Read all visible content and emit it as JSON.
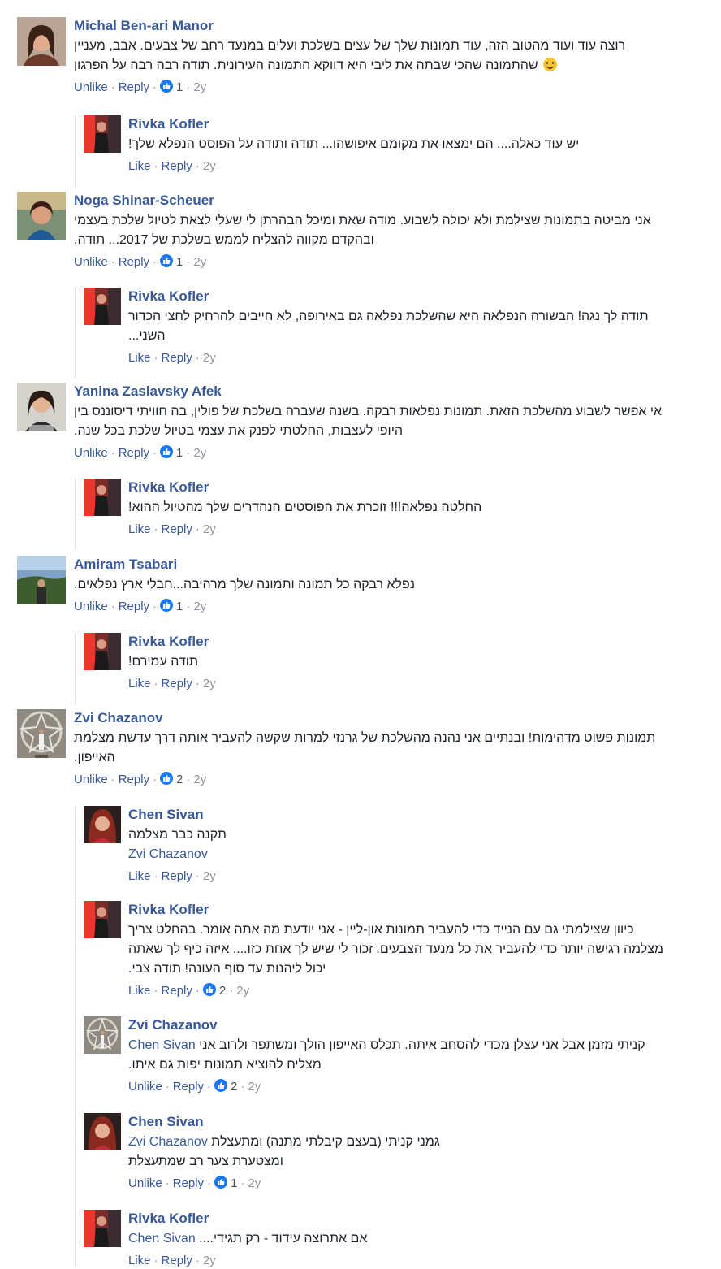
{
  "comments": [
    {
      "author": "Michal Ben-ari Manor",
      "lines": [
        "רוצה עוד ועוד מהטוב הזה, עוד תמונות שלך של עצים בשלכת ועלים במנעד רחב של צבעים. אבב, מעניין",
        "שהתמונה שהכי שבתה את ליבי היא דווקא התמונה העירונית. תודה רבה רבה על הפרגון"
      ],
      "action": "Unlike",
      "reply": "Reply",
      "likes": "1",
      "time": "2y"
    },
    {
      "author": "Rivka Kofler",
      "lines": [
        "יש עוד כאלה.... הם ימצאו את מקומם איפושהו... תודה ותודה על הפוסט הנפלא שלך!"
      ],
      "action": "Like",
      "reply": "Reply",
      "time": "2y"
    },
    {
      "author": "Noga Shinar-Scheuer",
      "lines": [
        "אני מביטה בתמונות שצילמת ולא יכולה לשבוע. מודה שאת ומיכל הבהרתן לי שעלי לצאת לטיול שלכת בעצמי",
        "ובהקדם מקווה להצליח לממש בשלכת של 2017... תודה."
      ],
      "action": "Unlike",
      "reply": "Reply",
      "likes": "1",
      "time": "2y"
    },
    {
      "author": "Rivka Kofler",
      "lines": [
        "תודה לך נגה! הבשורה הנפלאה היא שהשלכת נפלאה גם באירופה, לא חייבים להרחיק לחצי הכדור",
        "השני..."
      ],
      "action": "Like",
      "reply": "Reply",
      "time": "2y"
    },
    {
      "author": "Yanina Zaslavsky Afek",
      "lines": [
        "אי אפשר לשבוע מהשלכת הזאת. תמונות נפלאות רבקה. בשנה שעברה בשלכת של פולין, בה חוויתי דיסוננס בין",
        "היופי לעצבות, החלטתי לפנק את עצמי בטיול שלכת בכל שנה."
      ],
      "action": "Unlike",
      "reply": "Reply",
      "likes": "1",
      "time": "2y"
    },
    {
      "author": "Rivka Kofler",
      "lines": [
        "החלטה נפלאה!!! זוכרת את הפוסטים הנהדרים שלך מהטיול ההוא!"
      ],
      "action": "Like",
      "reply": "Reply",
      "time": "2y"
    },
    {
      "author": "Amiram Tsabari",
      "lines": [
        "נפלא רבקה כל תמונה ותמונה שלך מרהיבה...חבלי ארץ נפלאים."
      ],
      "action": "Unlike",
      "reply": "Reply",
      "likes": "1",
      "time": "2y"
    },
    {
      "author": "Rivka Kofler",
      "lines": [
        "תודה עמירם!"
      ],
      "action": "Like",
      "reply": "Reply",
      "time": "2y"
    },
    {
      "author": "Zvi Chazanov",
      "lines": [
        "תמונות פשוט מדהימות! ובנתיים אני נהנה מהשלכת של גרנזי למרות שקשה להעביר אותה דרך עדשת מצלמת",
        "האייפון."
      ],
      "action": "Unlike",
      "reply": "Reply",
      "likes": "2",
      "time": "2y"
    },
    {
      "author": "Chen Sivan",
      "lines": [
        "תקנה כבר מצלמה"
      ],
      "mention": "Zvi Chazanov",
      "action": "Like",
      "reply": "Reply",
      "time": "2y"
    },
    {
      "author": "Rivka Kofler",
      "lines": [
        "כיוון שצילמתי גם עם הנייד כדי להעביר תמונות און-ליין - אני יודעת מה אתה אומר. בהחלט צריך",
        "מצלמה רגישה יותר כדי להעביר את כל מנעד הצבעים. זכור לי שיש לך אחת כזו.... איזה כיף לך שאתה",
        "יכול ליהנות עד סוף העונה! תודה צבי."
      ],
      "action": "Like",
      "reply": "Reply",
      "likes": "2",
      "time": "2y"
    },
    {
      "author": "Zvi Chazanov",
      "mention": "Chen Sivan",
      "lines": [
        "קניתי מזמן אבל אני עצלן מכדי להסחב איתה. תכלס האייפון הולך ומשתפר ולרוב אני",
        "מצליח להוציא תמונות יפות גם איתו."
      ],
      "action": "Unlike",
      "reply": "Reply",
      "likes": "2",
      "time": "2y"
    },
    {
      "author": "Chen Sivan",
      "mention": "Zvi Chazanov",
      "lines": [
        "גמני קניתי (בעצם קיבלתי מתנה) ומתעצלת",
        "ומצטערת צער רב שמתעצלת"
      ],
      "action": "Unlike",
      "reply": "Reply",
      "likes": "1",
      "time": "2y"
    },
    {
      "author": "Rivka Kofler",
      "mention": "Chen Sivan",
      "lines": [
        "אם אתרוצה עידוד - רק תגידי...."
      ],
      "action": "Like",
      "reply": "Reply",
      "time": "2y"
    }
  ],
  "icons": {
    "like": "thumbs-up-icon",
    "smiley": "smiley-emoji-icon"
  },
  "colors": {
    "name": "#385898",
    "meta": "#90949c",
    "like_badge": "#1877f2"
  }
}
